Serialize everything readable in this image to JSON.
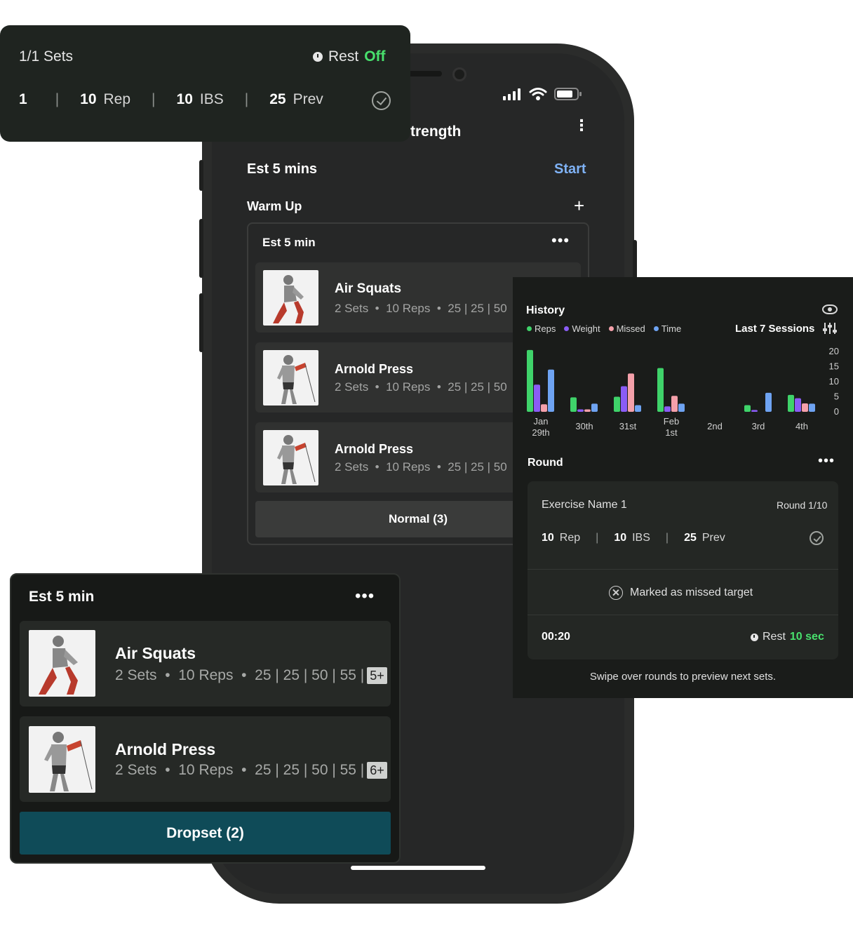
{
  "phone": {
    "title": "trength",
    "menu_icon": "kebab-icon",
    "est_label": "Est 5 mins",
    "start_label": "Start",
    "warmup_label": "Warm Up",
    "add_label": "+",
    "card": {
      "title": "Est 5 min",
      "dots": "•••",
      "items": [
        {
          "name": "Air Squats",
          "sets": "2 Sets",
          "reps": "10 Reps",
          "weights": "25 | 25 | 50"
        },
        {
          "name": "Arnold Press",
          "sets": "2 Sets",
          "reps": "10 Reps",
          "weights": "25 | 25 | 50"
        },
        {
          "name": "Arnold Press",
          "sets": "2 Sets",
          "reps": "10 Reps",
          "weights": "25 | 25 | 50"
        }
      ],
      "button_label": "Normal (3)"
    }
  },
  "sets_panel": {
    "title": "1/1 Sets",
    "rest_label": "Rest",
    "rest_value": "Off",
    "set_number": "1",
    "reps_value": "10",
    "reps_unit": "Rep",
    "weight_value": "10",
    "weight_unit": "IBS",
    "prev_value": "25",
    "prev_unit": "Prev"
  },
  "history": {
    "title": "History",
    "legend": [
      "Reps",
      "Weight",
      "Missed",
      "Time"
    ],
    "range_label": "Last 7 Sessions",
    "round_label": "Round",
    "round_dots": "•••",
    "round_card": {
      "exercise": "Exercise Name 1",
      "round": "Round 1/10",
      "reps_value": "10",
      "reps_unit": "Rep",
      "weight_value": "10",
      "weight_unit": "IBS",
      "prev_value": "25",
      "prev_unit": "Prev",
      "missed_text": "Marked as missed target",
      "timer": "00:20",
      "rest_label": "Rest",
      "rest_value": "10 sec"
    },
    "swipe_hint": "Swipe over rounds to preview next sets."
  },
  "chart_data": {
    "type": "bar",
    "categories": [
      "Jan 29th",
      "30th",
      "31st",
      "Feb 1st",
      "2nd",
      "3rd",
      "4th"
    ],
    "ylim": [
      0,
      20
    ],
    "yticks": [
      20,
      15,
      10,
      5,
      0
    ],
    "series": [
      {
        "name": "Reps",
        "color": "#3fd36a",
        "values": [
          20.5,
          4.8,
          5,
          14.5,
          0,
          2.2,
          5.6
        ]
      },
      {
        "name": "Weight",
        "color": "#8a5cf5",
        "values": [
          9,
          0.8,
          8.5,
          1.8,
          0,
          0.6,
          4.5
        ]
      },
      {
        "name": "Missed",
        "color": "#f4a0aa",
        "values": [
          2.5,
          0.8,
          12.7,
          5.3,
          0,
          0,
          2.8
        ]
      },
      {
        "name": "Time",
        "color": "#6ea3f2",
        "values": [
          14,
          2.7,
          2.2,
          2.7,
          0,
          6.3,
          2.7
        ]
      }
    ]
  },
  "drop_panel": {
    "title": "Est 5 min",
    "dots": "•••",
    "items": [
      {
        "name": "Air Squats",
        "sets": "2 Sets",
        "reps": "10 Reps",
        "weights": "25 | 25 | 50 | 55 |",
        "badge": "5+"
      },
      {
        "name": "Arnold Press",
        "sets": "2 Sets",
        "reps": "10 Reps",
        "weights": "25 | 25 | 50 | 55 |",
        "badge": "6+"
      }
    ],
    "button_label": "Dropset (2)"
  }
}
